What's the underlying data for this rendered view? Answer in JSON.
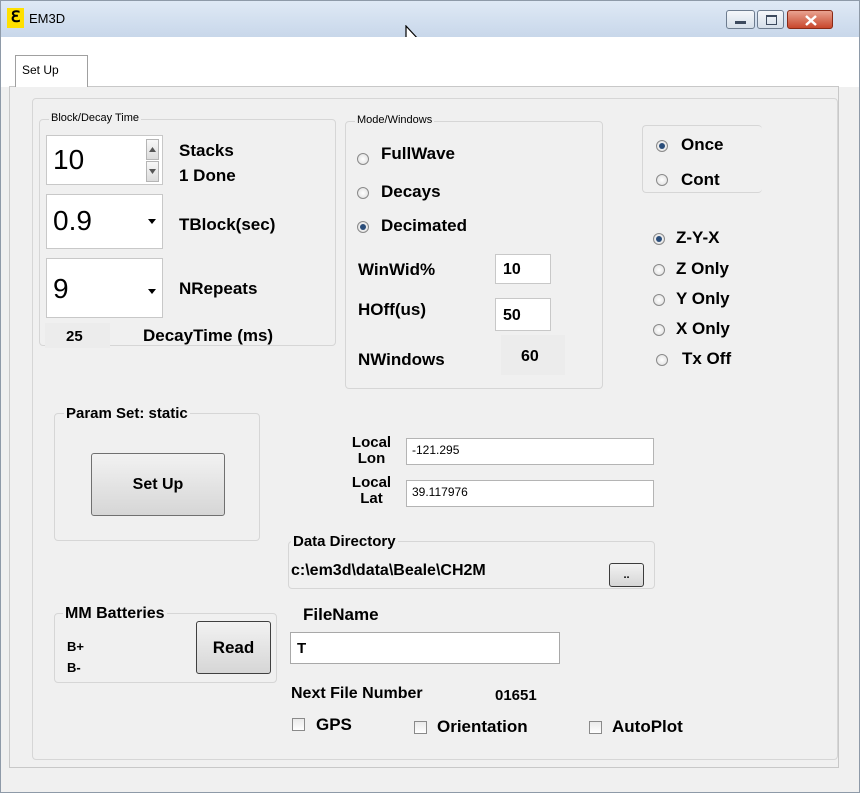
{
  "window": {
    "title": "EM3D",
    "app_icon": "ℇ"
  },
  "tabs": [
    {
      "label": "Set Up"
    }
  ],
  "block_decay": {
    "group_label": "Block/Decay Time",
    "stacks_value": "10",
    "stacks_label": "Stacks",
    "done_label": "1 Done",
    "tblock_value": "0.9",
    "tblock_label": "TBlock(sec)",
    "nrepeats_value": "9",
    "nrepeats_label": "NRepeats",
    "decay_value": "25",
    "decay_label": "DecayTime (ms)"
  },
  "mode_windows": {
    "group_label": "Mode/Windows",
    "options": [
      {
        "label": "FullWave",
        "selected": false
      },
      {
        "label": "Decays",
        "selected": false
      },
      {
        "label": "Decimated",
        "selected": true
      }
    ],
    "winwid_label": "WinWid%",
    "winwid_value": "10",
    "hoff_label": "HOff(us)",
    "hoff_value": "50",
    "nwindows_label": "NWindows",
    "nwindows_value": "60"
  },
  "run_mode": [
    {
      "label": "Once",
      "selected": true
    },
    {
      "label": "Cont",
      "selected": false
    }
  ],
  "axes": [
    {
      "label": "Z-Y-X",
      "selected": true
    },
    {
      "label": "Z Only",
      "selected": false
    },
    {
      "label": "Y Only",
      "selected": false
    },
    {
      "label": "X Only",
      "selected": false
    },
    {
      "label": "Tx Off",
      "selected": false
    }
  ],
  "param_set": {
    "label": "Param Set: static",
    "button": "Set Up"
  },
  "location": {
    "lon_label_1": "Local",
    "lon_label_2": "Lon",
    "lon_value": "-121.295",
    "lat_label_1": "Local",
    "lat_label_2": "Lat",
    "lat_value": "39.117976"
  },
  "data_directory": {
    "label": "Data Directory",
    "path": "c:\\em3d\\data\\Beale\\CH2M",
    "browse_label": ".."
  },
  "batteries": {
    "label": "MM Batteries",
    "b_plus": "B+",
    "b_minus": "B-",
    "read_button": "Read"
  },
  "file": {
    "label": "FileName",
    "value": "T",
    "next_label": "Next File Number",
    "next_value": "01651"
  },
  "checkboxes": [
    {
      "label": "GPS",
      "checked": false
    },
    {
      "label": "Orientation",
      "checked": false
    },
    {
      "label": "AutoPlot",
      "checked": false
    }
  ]
}
